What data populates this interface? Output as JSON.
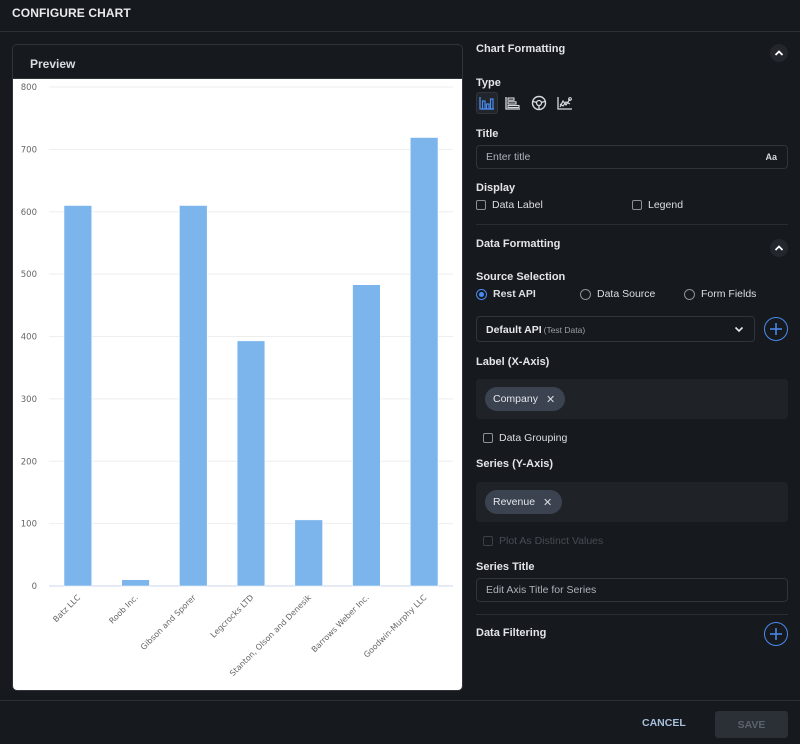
{
  "header": {
    "title": "CONFIGURE CHART"
  },
  "preview": {
    "title": "Preview"
  },
  "chart_data": {
    "type": "bar",
    "title": "",
    "xlabel": "",
    "ylabel": "",
    "categories": [
      "Batz LLC",
      "Roob Inc.",
      "Gibson and Sporer",
      "Legcrocks LTD",
      "Stanton, Olson and Denesik",
      "Barrows Weber Inc.",
      "Goodwin-Murphy LLC"
    ],
    "series": [
      {
        "name": "Revenue",
        "values": [
          610,
          10,
          610,
          393,
          106,
          483,
          719
        ]
      }
    ],
    "ylim": [
      0,
      800
    ],
    "yticks": [
      0,
      100,
      200,
      300,
      400,
      500,
      600,
      700,
      800
    ],
    "grid": true,
    "legend": "none",
    "bar_color": "#7cb5ec"
  },
  "chart_formatting": {
    "heading": "Chart Formatting",
    "type_label": "Type",
    "types": [
      {
        "name": "column-chart",
        "active": true
      },
      {
        "name": "horizontal-bar-chart",
        "active": false
      },
      {
        "name": "pie-chart",
        "active": false
      },
      {
        "name": "line-chart",
        "active": false
      }
    ],
    "title_label": "Title",
    "title_placeholder": "Enter title",
    "title_value": "",
    "font_button": "Aa",
    "display_label": "Display",
    "data_label": "Data Label",
    "data_label_checked": false,
    "legend_label": "Legend",
    "legend_checked": false
  },
  "data_formatting": {
    "heading": "Data Formatting",
    "source_label": "Source Selection",
    "sources": [
      {
        "label": "Rest API",
        "checked": true
      },
      {
        "label": "Data Source",
        "checked": false
      },
      {
        "label": "Form Fields",
        "checked": false
      }
    ],
    "api_select": {
      "value": "Default API",
      "sub": "(Test Data)"
    },
    "x_axis_label": "Label (X-Axis)",
    "x_axis_chip": "Company",
    "data_grouping": "Data Grouping",
    "data_grouping_checked": false,
    "y_axis_label": "Series (Y-Axis)",
    "y_axis_chip": "Revenue",
    "plot_distinct": "Plot As Distinct Values",
    "series_title_label": "Series Title",
    "series_title_placeholder": "Edit Axis Title for Series",
    "series_title_value": ""
  },
  "data_filtering": {
    "heading": "Data Filtering"
  },
  "footer": {
    "cancel": "CANCEL",
    "save": "SAVE"
  },
  "colors": {
    "accent": "#4a8cf0",
    "bar": "#7cb5ec",
    "background": "#16191e"
  }
}
